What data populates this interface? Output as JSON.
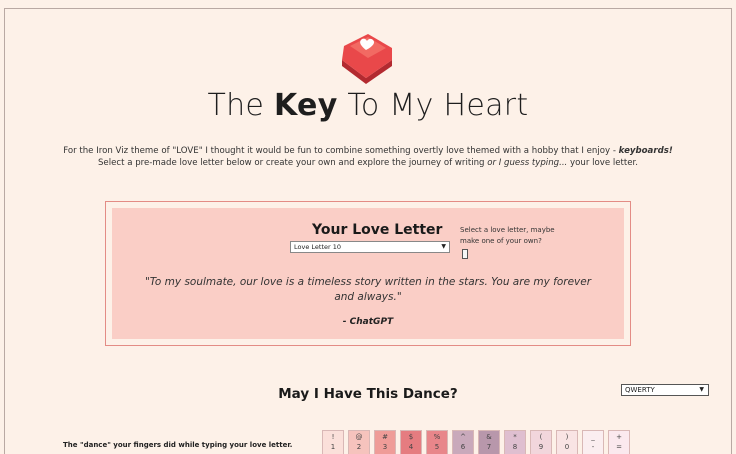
{
  "header": {
    "title_pre": "The ",
    "title_bold": "Key",
    "title_post": " To My Heart"
  },
  "intro": {
    "line1_a": "For the Iron Viz theme of \"LOVE\" I thought it would be fun to combine something overtly love themed with a hobby that I enjoy - ",
    "line1_b": "keyboards!",
    "line2_a": "Select a pre-made love letter below or create your own and explore the journey of writing ",
    "line2_b": "or I guess typing...",
    "line2_c": " your love letter."
  },
  "letter": {
    "title": "Your Love Letter",
    "selected": "Love Letter 10",
    "hint": "Select a love letter, maybe make one of your own?",
    "quote": "\"To my soulmate, our love is a timeless story written in the stars. You are my forever and always.\"",
    "attribution": "- ChatGPT"
  },
  "dance": {
    "title": "May I Have This Dance?",
    "layout_selected": "QWERTY",
    "description": "The \"dance\" your fingers did while typing your love letter."
  },
  "keys": [
    {
      "top": "!",
      "bottom": "1",
      "color": "#fbe0da"
    },
    {
      "top": "@",
      "bottom": "2",
      "color": "#f6c3bd"
    },
    {
      "top": "#",
      "bottom": "3",
      "color": "#ef9c98"
    },
    {
      "top": "$",
      "bottom": "4",
      "color": "#e57c80"
    },
    {
      "top": "%",
      "bottom": "5",
      "color": "#e8868a"
    },
    {
      "top": "^",
      "bottom": "6",
      "color": "#c9a9bb"
    },
    {
      "top": "&",
      "bottom": "7",
      "color": "#b897ab"
    },
    {
      "top": "*",
      "bottom": "8",
      "color": "#dfbfd0"
    },
    {
      "top": "(",
      "bottom": "9",
      "color": "#f2d6dc"
    },
    {
      "top": ")",
      "bottom": "0",
      "color": "#f9e4e4"
    },
    {
      "top": "_",
      "bottom": "-",
      "color": "#fbeef0"
    },
    {
      "top": "+",
      "bottom": "=",
      "color": "#fbe9ee"
    }
  ],
  "colors": {
    "background": "#fdf1e8",
    "letter_panel": "#facec6",
    "panel_border": "#e38c85",
    "keycap": "#e9484a"
  },
  "icons": {
    "logo": "heart-keycap-icon",
    "dropdown": "chevron-down-icon"
  }
}
